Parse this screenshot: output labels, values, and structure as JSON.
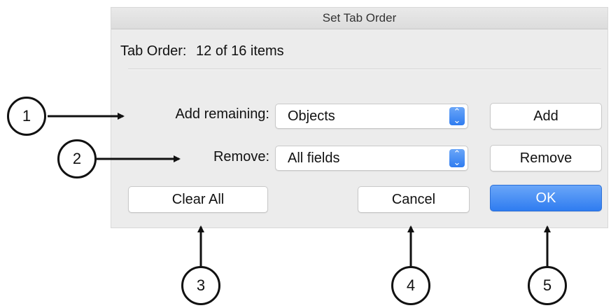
{
  "dialog": {
    "title": "Set Tab Order",
    "summary_label": "Tab Order:",
    "summary_value": "12 of 16 items",
    "add_remaining": {
      "label": "Add remaining:",
      "select_value": "Objects",
      "button_label": "Add"
    },
    "remove": {
      "label": "Remove:",
      "select_value": "All fields",
      "button_label": "Remove"
    },
    "buttons": {
      "clear_all": "Clear All",
      "cancel": "Cancel",
      "ok": "OK"
    }
  },
  "callouts": [
    "1",
    "2",
    "3",
    "4",
    "5"
  ],
  "colors": {
    "accent": "#2f7cf0",
    "dialog_bg": "#ececec"
  },
  "icons": {
    "select_stepper": "up-down-chevron-icon"
  }
}
